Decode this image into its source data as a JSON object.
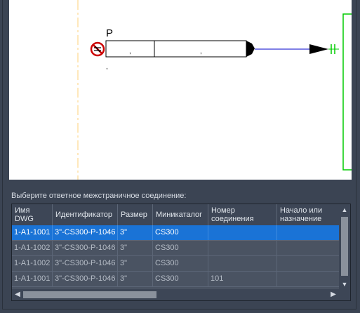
{
  "drawing": {
    "pipe_label": "P",
    "dim_marks": [
      ",",
      ",",
      ","
    ]
  },
  "prompt": "Выберите ответное межстраничное соединение:",
  "grid": {
    "columns": [
      {
        "label": "Имя DWG"
      },
      {
        "label": "Идентификатор"
      },
      {
        "label": "Размер"
      },
      {
        "label": "Миникаталог"
      },
      {
        "label": "Номер соединения"
      },
      {
        "label": "Начало или назначение"
      }
    ],
    "rows": [
      {
        "cells": [
          "1-A1-1001",
          "3\"-CS300-P-1046",
          "3\"",
          "CS300",
          "",
          ""
        ],
        "selected": true
      },
      {
        "cells": [
          "1-A1-1002",
          "3\"-CS300-P-1046",
          "3\"",
          "CS300",
          "",
          ""
        ],
        "selected": false
      },
      {
        "cells": [
          "1-A1-1002",
          "3\"-CS300-P-1046",
          "3\"",
          "CS300",
          "",
          ""
        ],
        "selected": false
      },
      {
        "cells": [
          "1-A1-1001",
          "3\"-CS300-P-1046",
          "3\"",
          "CS300",
          "101",
          ""
        ],
        "selected": false
      }
    ],
    "icons": {
      "scroll_up": "▲",
      "scroll_down": "▼",
      "scroll_left": "◀",
      "scroll_right": "▶"
    }
  },
  "colors": {
    "background": "#3b4453",
    "selection": "#1a73d6",
    "pipe_line": "#0000cc",
    "connector": "#00cc00",
    "centerline": "#ffd27a"
  }
}
